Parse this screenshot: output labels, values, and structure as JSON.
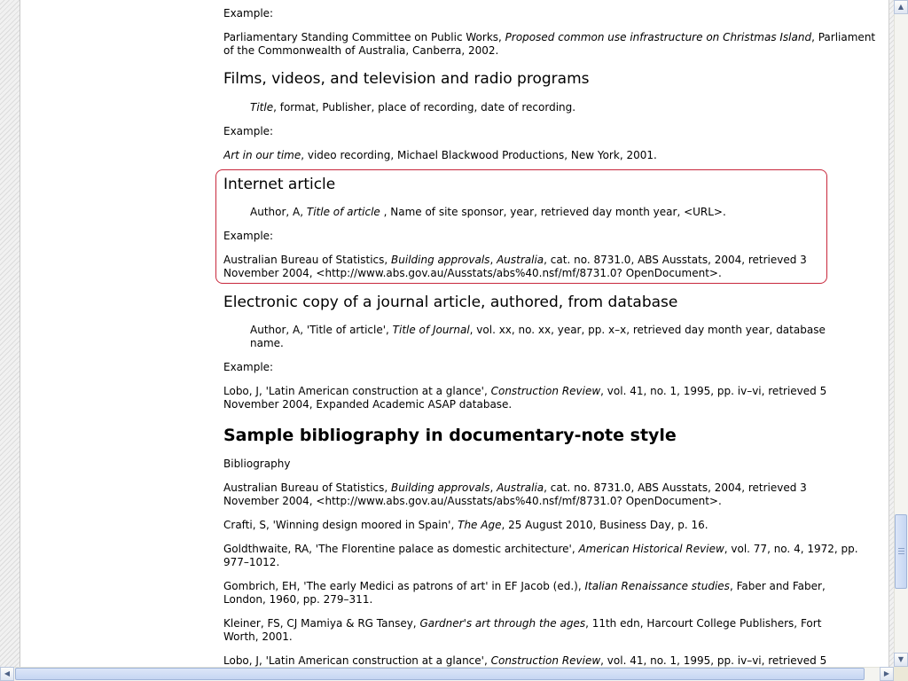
{
  "top": {
    "example_label": "Example:",
    "parliament_a": "Parliamentary Standing Committee on Public Works, ",
    "parliament_em": "Proposed common use infrastructure on Christmas Island",
    "parliament_b": ", Parliament of the Commonwealth of Australia, Canberra, 2002."
  },
  "films": {
    "heading": "Films, videos, and television and radio programs",
    "format_em": "Title",
    "format_rest": ", format, Publisher, place of recording, date of recording.",
    "example_label": "Example:",
    "example_em": "Art in our time",
    "example_rest": ", video recording, Michael Blackwood Productions, New York, 2001."
  },
  "internet": {
    "heading": "Internet article",
    "format_a": "Author, A, ",
    "format_em": "Title of article",
    "format_b": " , Name of site sponsor, year, retrieved day month year, <URL>.",
    "example_label": "Example:",
    "example_a": "Australian Bureau of Statistics, ",
    "example_em1": "Building approvals",
    "example_sep": ", ",
    "example_em2": "Australia",
    "example_b": ", cat. no. 8731.0, ABS Ausstats, 2004, retrieved 3 November 2004, <http://www.abs.gov.au/Ausstats/abs%40.nsf/mf/8731.0? OpenDocument>."
  },
  "electronic": {
    "heading": "Electronic copy of a journal article, authored, from database",
    "format_a": "Author, A, 'Title of article', ",
    "format_em": "Title of Journal",
    "format_b": ", vol. xx, no. xx, year, pp. x–x, retrieved day month year, database name.",
    "example_label": "Example:",
    "example_a": "Lobo, J, 'Latin American construction at a glance', ",
    "example_em": "Construction Review",
    "example_b": ", vol. 41, no. 1, 1995, pp. iv–vi, retrieved 5 November 2004, Expanded Academic ASAP database."
  },
  "bibliography": {
    "heading": "Sample bibliography in documentary-note style",
    "label": "Bibliography",
    "entries": [
      {
        "a": "Australian Bureau of Statistics, ",
        "em": "Building approvals",
        "mid": ", ",
        "em2": "Australia",
        "b": ", cat. no. 8731.0, ABS Ausstats, 2004, retrieved 3 November 2004, <http://www.abs.gov.au/Ausstats/abs%40.nsf/mf/8731.0? OpenDocument>."
      },
      {
        "a": "Crafti, S, 'Winning design moored in Spain', ",
        "em": "The Age",
        "b": ", 25 August 2010, Business Day, p. 16."
      },
      {
        "a": "Goldthwaite, RA, 'The Florentine palace as domestic architecture', ",
        "em": "American Historical Review",
        "b": ", vol. 77, no. 4, 1972, pp. 977–1012."
      },
      {
        "a": "Gombrich, EH, 'The early Medici as patrons of art' in EF Jacob (ed.), ",
        "em": "Italian Renaissance studies",
        "b": ", Faber and Faber, London, 1960, pp. 279–311."
      },
      {
        "a": "Kleiner, FS, CJ Mamiya & RG Tansey, ",
        "em": "Gardner's art through the ages",
        "b": ", 11th edn, Harcourt College Publishers, Fort Worth, 2001."
      },
      {
        "a": "Lobo, J, 'Latin American construction at a glance', ",
        "em": "Construction Review",
        "b": ", vol. 41, no. 1, 1995, pp. iv–vi, retrieved 5"
      }
    ]
  },
  "colors": {
    "highlight_border": "#c8283c",
    "scrollbar_thumb": "#c6d6f2"
  }
}
